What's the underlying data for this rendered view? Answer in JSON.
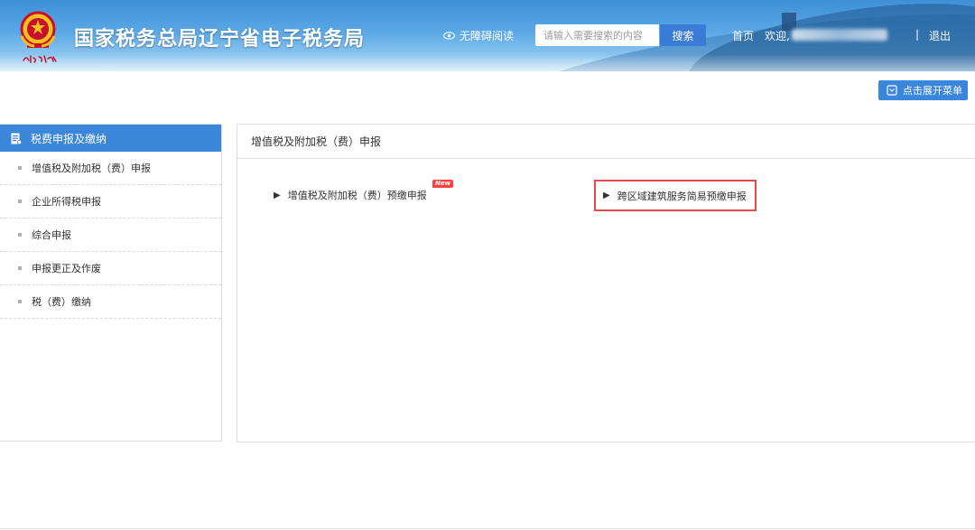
{
  "header": {
    "title": "国家税务总局辽宁省电子税务局",
    "seal_text": "精诚协作",
    "accessibility_label": "无障碍阅读",
    "search_placeholder": "请输入需要搜索的内容",
    "search_button": "搜索",
    "home_label": "首页",
    "welcome_label": "欢迎,",
    "separator": "|",
    "logout_label": "退出"
  },
  "toolbar": {
    "expand_menu_label": "点击展开菜单"
  },
  "sidebar": {
    "heading": "税费申报及缴纳",
    "items": [
      {
        "label": "增值税及附加税（费）申报"
      },
      {
        "label": "企业所得税申报"
      },
      {
        "label": "综合申报"
      },
      {
        "label": "申报更正及作废"
      },
      {
        "label": "税（费）缴纳"
      }
    ]
  },
  "main": {
    "panel_title": "增值税及附加税（费）申报",
    "entries": [
      {
        "label": "增值税及附加税（费）预缴申报",
        "badge": "New"
      },
      {
        "label": "跨区域建筑服务简易预缴申报",
        "highlighted": true
      }
    ]
  },
  "colors": {
    "accent": "#3a86db",
    "highlight_border": "#e34b4b",
    "badge": "#ff4040"
  },
  "icons": {
    "emblem": "national-emblem-icon",
    "accessibility": "eye-icon",
    "expand_menu": "menu-icon",
    "sidebar_heading": "document-icon",
    "entry_marker": "triangle-right-icon"
  }
}
